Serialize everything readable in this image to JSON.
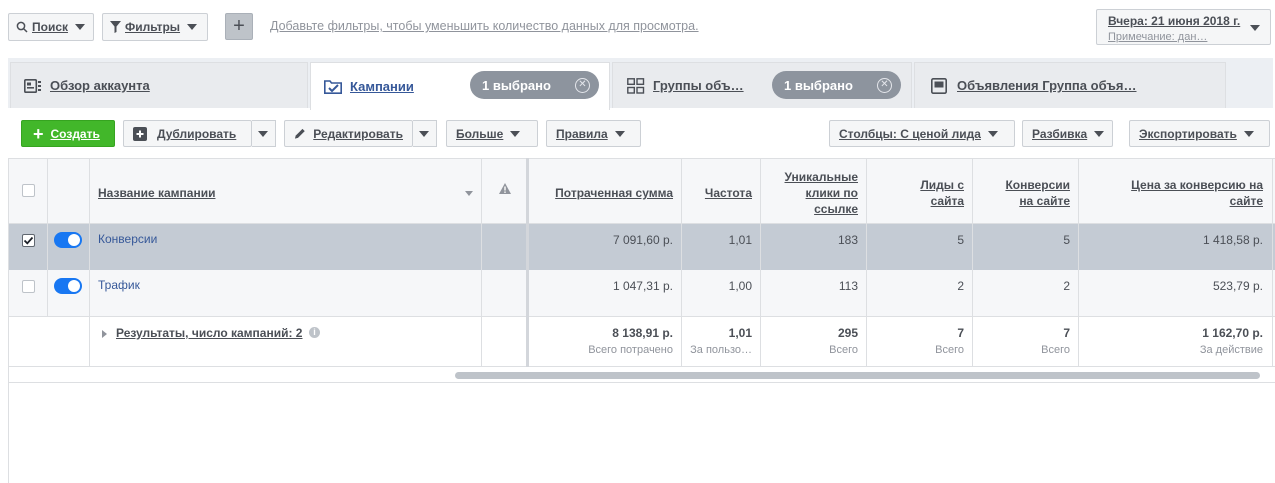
{
  "filter_bar": {
    "search_label": "Поиск",
    "filters_label": "Фильтры",
    "add_button": "+",
    "hint": "Добавьте фильтры, чтобы уменьшить количество данных для просмотра."
  },
  "date_picker": {
    "date": "Вчера: 21 июня 2018 г.",
    "note": "Примечание: дан…"
  },
  "tabs": [
    {
      "label": "Обзор аккаунта",
      "icon": "account-overview-icon"
    },
    {
      "label": "Кампании",
      "icon": "folder-check-icon",
      "selected_badge": "1 выбрано",
      "active": true
    },
    {
      "label": "Группы объ…",
      "icon": "grid-icon",
      "selected_badge": "1 выбрано"
    },
    {
      "label": "Объявления Группа объя…",
      "icon": "ad-monitor-icon"
    }
  ],
  "toolbar": {
    "create": "Создать",
    "duplicate": "Дублировать",
    "edit": "Редактировать",
    "more": "Больше",
    "rules": "Правила",
    "columns": "Столбцы: С ценой лида",
    "breakdown": "Разбивка",
    "export": "Экспортировать"
  },
  "table": {
    "headers": {
      "name": "Название кампании",
      "spent": "Потраченная сумма",
      "frequency": "Частота",
      "unique_clicks_1": "Уникальные",
      "unique_clicks_2": "клики по",
      "unique_clicks_3": "ссылке",
      "leads_1": "Лиды с",
      "leads_2": "сайта",
      "conv_1": "Конверсии",
      "conv_2": "на сайте",
      "cpa_1": "Цена за конверсию на",
      "cpa_2": "сайте"
    },
    "rows": [
      {
        "name": "Конверсии",
        "checked": true,
        "on": true,
        "spent": "7 091,60 р.",
        "frequency": "1,01",
        "clicks": "183",
        "leads": "5",
        "conversions": "5",
        "cpa": "1 418,58 р."
      },
      {
        "name": "Трафик",
        "checked": false,
        "on": true,
        "spent": "1 047,31 р.",
        "frequency": "1,00",
        "clicks": "113",
        "leads": "2",
        "conversions": "2",
        "cpa": "523,79 р."
      }
    ],
    "summary": {
      "label": "Результаты, число кампаний: 2",
      "spent": "8 138,91 р.",
      "spent_sub": "Всего потрачено",
      "frequency": "1,01",
      "frequency_sub": "За пользо…",
      "clicks": "295",
      "clicks_sub": "Всего",
      "leads": "7",
      "leads_sub": "Всего",
      "conversions": "7",
      "conversions_sub": "Всего",
      "cpa": "1 162,70 р.",
      "cpa_sub": "За действие"
    }
  },
  "colors": {
    "accent_blue": "#365899",
    "create_green": "#42b72a",
    "toggle_blue": "#1877f2",
    "selected_row": "#c4cbd4"
  }
}
